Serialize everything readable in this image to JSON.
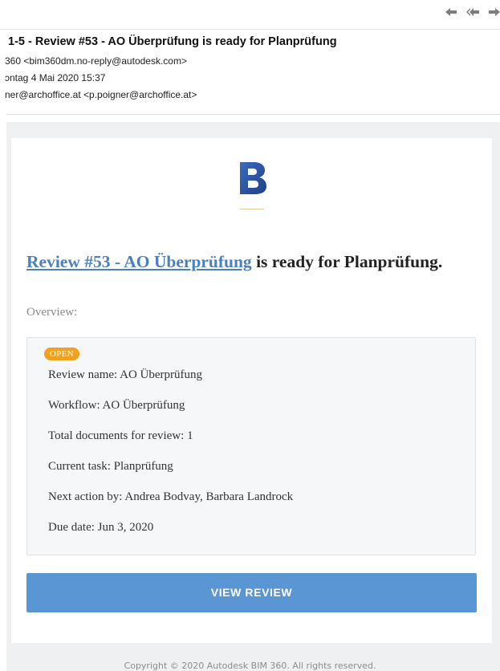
{
  "toolbar": {
    "reply_icon": "reply-arrow-icon",
    "reply_all_icon": "reply-all-icon",
    "forward_icon": "forward-arrow-icon"
  },
  "email": {
    "subject": "1-5 - Review #53 - AO Überprüfung is ready for Planprüfung",
    "from": "360 <bim360dm.no-reply@autodesk.com>",
    "date": "ɔntag 4 Mai 2020 15:37",
    "to": "ner@archoffice.at <p.poigner@archoffice.at>"
  },
  "body": {
    "logo_letter": "B",
    "headline_link": "Review #53 - AO Überprüfung",
    "headline_rest": " is ready for Planprüfung.",
    "overview_label": "Overview:",
    "status_badge": "OPEN",
    "details": [
      "Review name: AO Überprüfung",
      "Workflow: AO Überprüfung",
      "Total documents for review: 1",
      "Current task: Planprüfung",
      "Next action by: Andrea Bodvay, Barbara Landrock",
      "Due date: Jun 3, 2020"
    ],
    "button_label": "VIEW REVIEW",
    "footer": "Copyright © 2020 Autodesk BIM 360. All rights reserved."
  },
  "colors": {
    "link": "#4a80bd",
    "badge": "#f0a11e",
    "button": "#5a96d3",
    "logo": "#2b59a8"
  }
}
